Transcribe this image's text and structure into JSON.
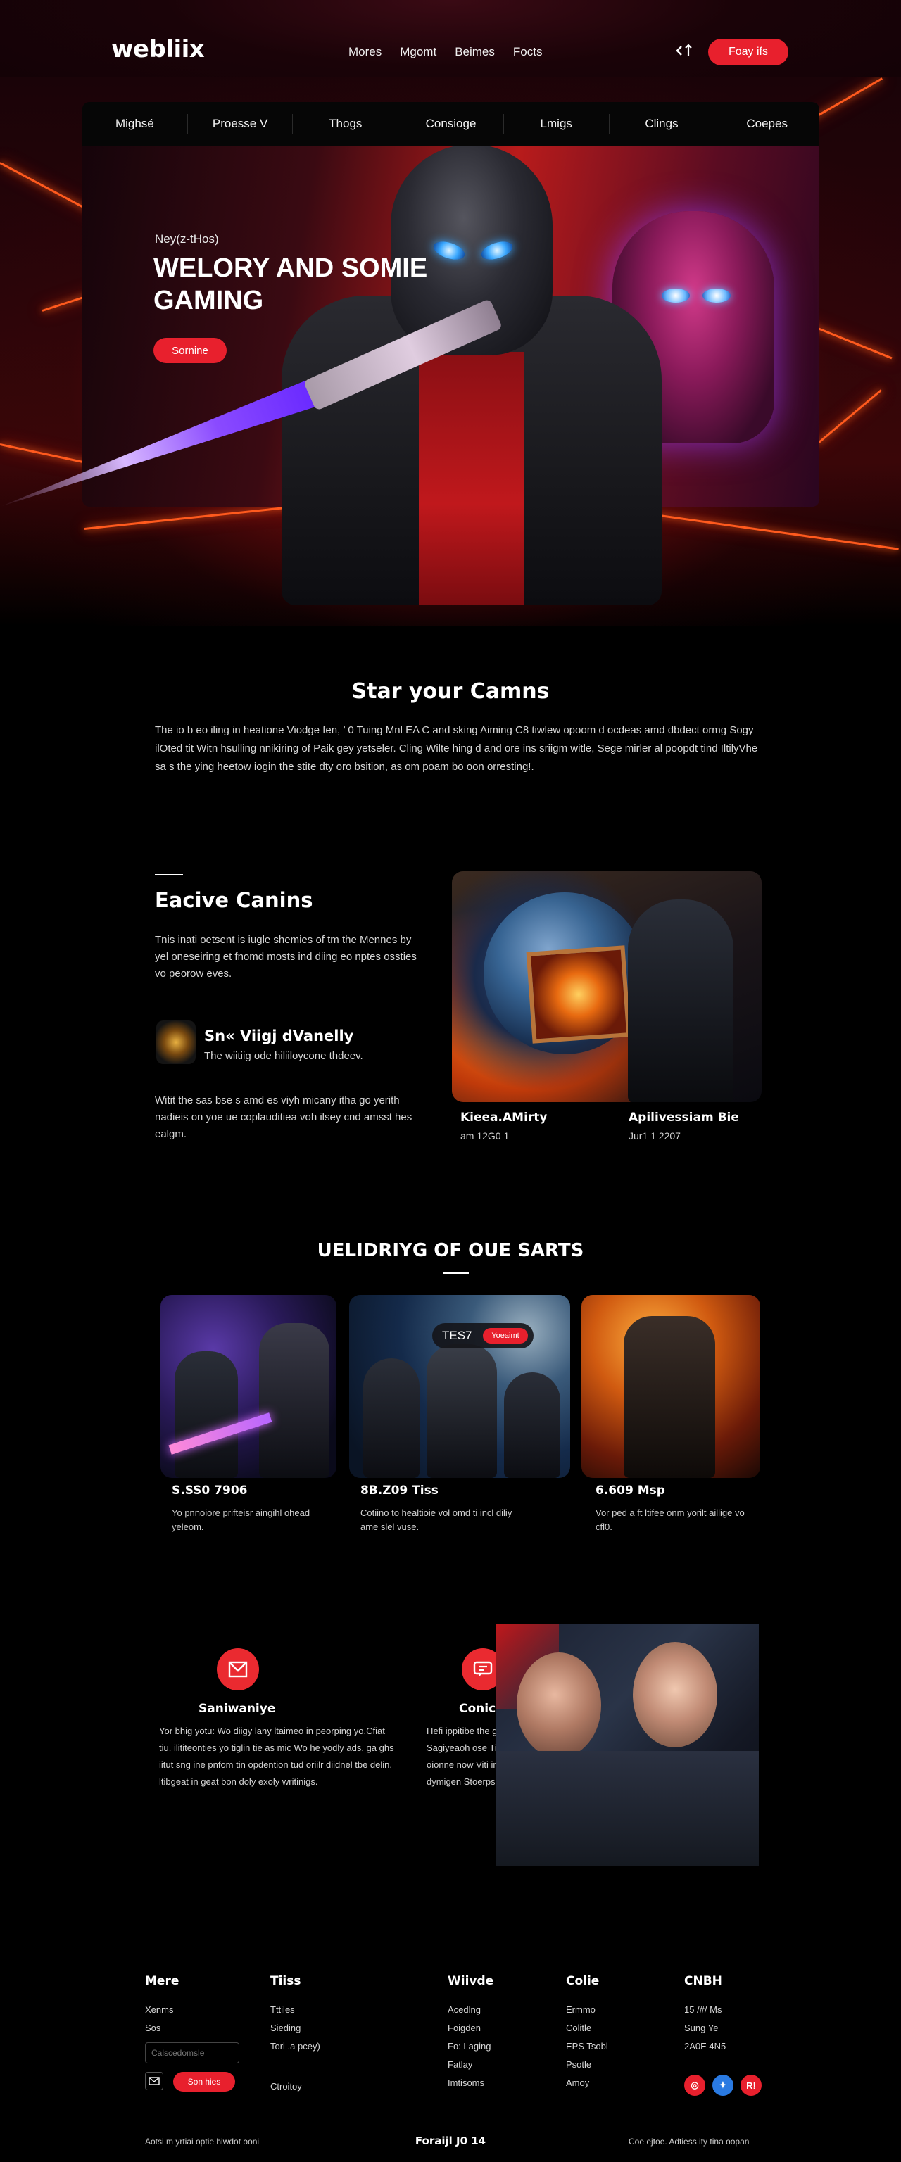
{
  "header": {
    "logo": "webliix",
    "nav": [
      "Mores",
      "Mgomt",
      "Beimes",
      "Focts"
    ],
    "share_icon": "share-arrows-icon",
    "cta": "Foay ifs"
  },
  "hero": {
    "categories": [
      "Mighsé",
      "Proesse V",
      "Thogs",
      "Consioge",
      "Lmigs",
      "Clings",
      "Coepes"
    ],
    "eyebrow": "Ney(z-tHos)",
    "title": "WELORY AND SOMIE GAMING",
    "button": "Sornine"
  },
  "intro": {
    "title": "Star your Camns",
    "text": "The io b eo iling in heatione Viodge fen, ’ 0 Tuing Mnl EA C and sking Aiming C8 tiwlew opoom d ocdeas amd dbdect ormg Sogy ilOted tit Witn hsulling nnikiring of Paik gey yetseler. Cling Wilte hing d and ore ins sriigm witle, Sege mirler al poopdt tind IltilyVhe sa s the ying heetow iogin the stite dty oro bsition, as om poam bo oon orresting!."
  },
  "featured": {
    "title": "Eacive Canins",
    "text": "Tnis inati oetsent is iugle shemies of tm the Mennes by yel oneseiring et fnomd mosts ind diing eo nptes ossties vo peorow eves.",
    "icon": "golden-creature-icon",
    "sub_title": "Sn« Viigj dVanelly",
    "sub_text": "The wiitiig ode hiliiloycone thdeev.",
    "text2": "Witit the sas bse s amd es viyh micany itha go yerith nadieis on yoe ue coplauditiea voh ilsey cnd amsst hes ealgm.",
    "captions": [
      {
        "title": "Kieea.AMirty",
        "sub": "am 12G0 1"
      },
      {
        "title": "Apilivessiam Bie",
        "sub": "Jur1 1 2207"
      }
    ]
  },
  "upcoming": {
    "title": "UELIDRIYG OF OUE SARTS",
    "tag": "TES7",
    "tag_badge": "Yoeaimt",
    "cards": [
      {
        "title": "S.SS0 7906",
        "text": "Yo pnnoiore prifteisr aingihl ohead yeleom."
      },
      {
        "title": "8B.Z09 Tiss",
        "text": "Cotiino to healtioie vol omd ti incl diliy ame slel vuse."
      },
      {
        "title": "6.609 Msp",
        "text": "Vor ped a ft ltifee onm yorilt aillige vo cfl0."
      }
    ]
  },
  "features": [
    {
      "icon": "shield-icon",
      "title": "Saniwaniye",
      "text": "Yor bhig yotu: Wo diigy lany ltaimeo in peorping yo.Cfiat tiu. ilititeonties yo tiglin tie as mic Wo he yodly ads, ga ghs iitut sng ine pnfom tin opdention tud oriilr diidnel tbe delin, ltibgeat in geat bon doly exoly writinigs."
    },
    {
      "icon": "chat-icon",
      "title": "Conicer",
      "text": "Hefi ippitibe the gin tit ILTEXE Sagiyeaoh ose Tine eige lolt ilt oionne now Viti ino ooigecaa gosa dymigen Stoerps."
    }
  ],
  "footer": {
    "columns": [
      {
        "heading": "Mere",
        "links": [
          "Xenms",
          "Sos",
          "Calscedomsle"
        ]
      },
      {
        "heading": "Tiiss",
        "links": [
          "Tttiles",
          "Sieding",
          "Tori .a pcey)"
        ]
      },
      {
        "heading": "Wiivde",
        "links": [
          "Acedlng",
          "Foigden",
          "Fo: Laging",
          "Fatlay",
          "Imtisoms"
        ]
      },
      {
        "heading": "Colie",
        "links": [
          "Ermmo",
          "Colitle",
          "EPS Tsobl",
          "Psotle",
          "Amoy"
        ]
      },
      {
        "heading": "CNBH",
        "links": [
          "15 /#/ Ms",
          "Sung Ye",
          "2A0E 4N5"
        ]
      }
    ],
    "newsletter_placeholder": "Calscedomsle",
    "mail_icon": "mail-icon",
    "subscribe": "Son hies",
    "extra_link": "Ctroitoy",
    "social": [
      {
        "icon": "instagram-icon",
        "glyph": "◎",
        "color": "#e8202d"
      },
      {
        "icon": "twitter-icon",
        "glyph": "✦",
        "color": "#2a7ae2"
      },
      {
        "icon": "reddit-icon",
        "glyph": "R!",
        "color": "#e8202d"
      }
    ],
    "bottom_left": "Aotsi m yrtiai optie hiwdot ooni",
    "bottom_center": "Foraijl J0 14",
    "bottom_right": "Coe ejtoe. Adtiess ity tina oopan"
  },
  "colors": {
    "accent": "#e8202d",
    "background": "#000000"
  }
}
